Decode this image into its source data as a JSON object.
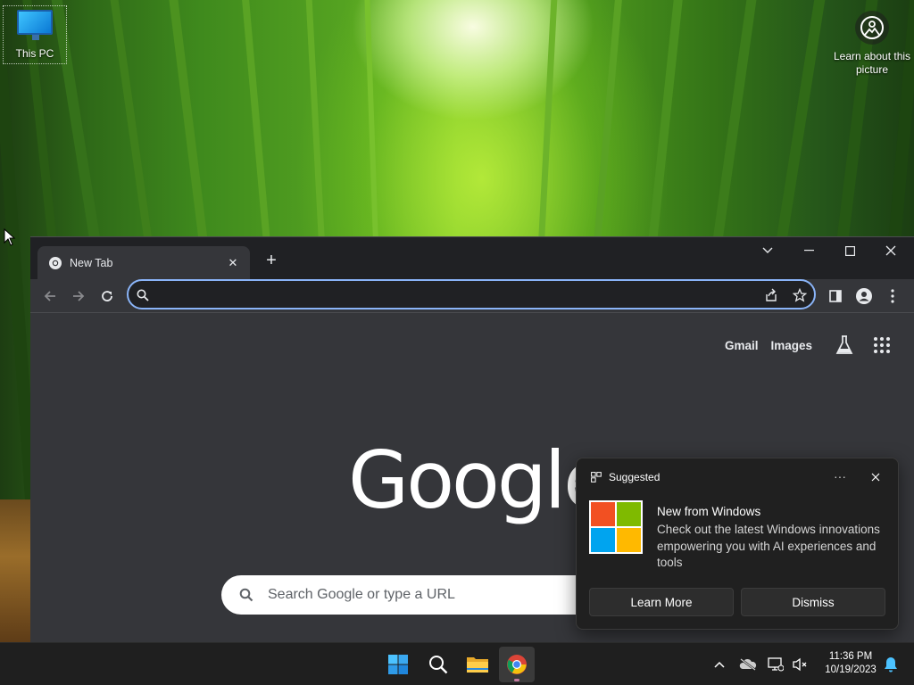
{
  "desktop": {
    "icons": [
      {
        "label": "This PC"
      },
      {
        "label": "Learn about this picture"
      }
    ]
  },
  "browser": {
    "tab": {
      "title": "New Tab"
    },
    "omnibox": {
      "value": "",
      "placeholder": ""
    },
    "new_tab_page": {
      "links": {
        "gmail": "Gmail",
        "images": "Images"
      },
      "logo_text": "Google",
      "search_placeholder": "Search Google or type a URL"
    }
  },
  "notification": {
    "header": "Suggested",
    "more": "···",
    "title": "New from Windows",
    "body": "Check out the latest Windows innovations empowering you with AI experiences and tools",
    "buttons": {
      "primary": "Learn More",
      "secondary": "Dismiss"
    }
  },
  "taskbar": {
    "apps": [
      "start-icon",
      "search-icon",
      "file-explorer-icon",
      "chrome-icon"
    ],
    "clock": {
      "time": "11:36 PM",
      "date": "10/19/2023"
    }
  },
  "colors": {
    "accent": "#8ab4f8",
    "chrome_bg": "#35363a",
    "titlebar_bg": "#202124",
    "toast_bg": "#202020",
    "ms_red": "#f25022",
    "ms_green": "#7fba00",
    "ms_blue": "#00a4ef",
    "ms_yellow": "#ffb900"
  }
}
